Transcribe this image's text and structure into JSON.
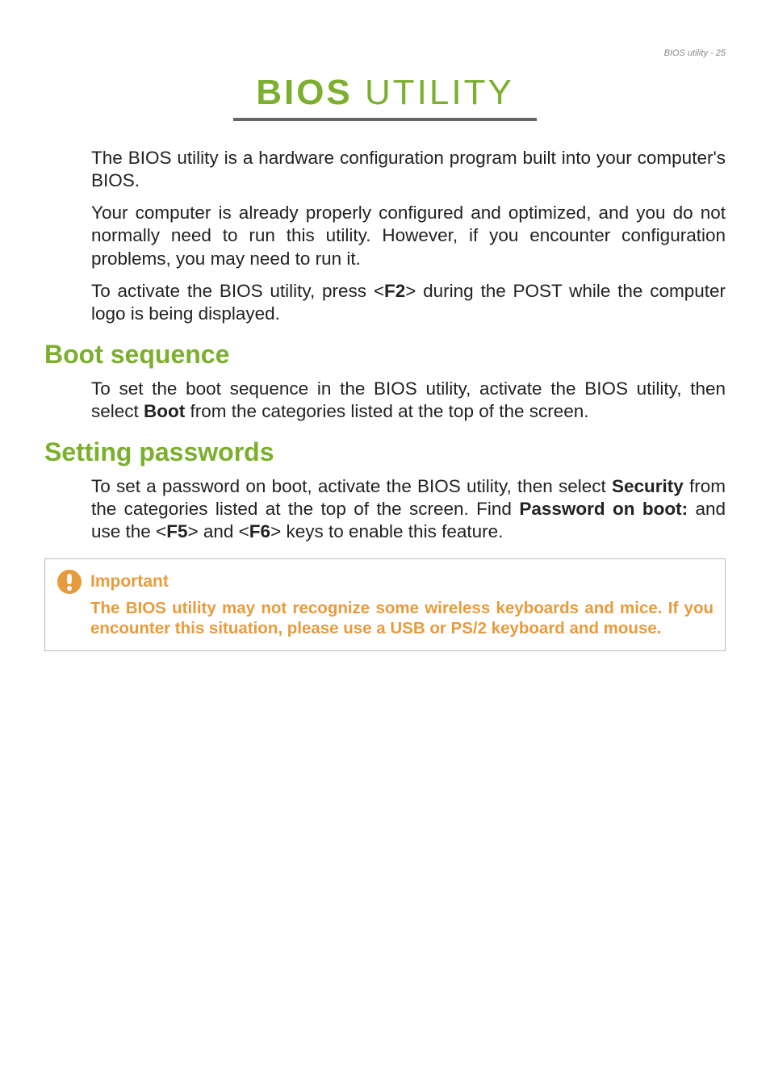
{
  "header": {
    "running_head": "BIOS utility - 25"
  },
  "title": {
    "bios": "BIOS",
    "utility": " UTILITY"
  },
  "intro": {
    "p1": "The BIOS utility is a hardware configuration program built into your computer's BIOS.",
    "p2": "Your computer is already properly configured and optimized, and you do not normally need to run this utility. However, if you encounter configuration problems, you may need to run it.",
    "p3_a": "To activate the BIOS utility, press <",
    "p3_key": "F2",
    "p3_b": "> during the POST while the computer logo is being displayed."
  },
  "sections": {
    "boot": {
      "heading": "Boot sequence",
      "p1_a": "To set the boot sequence in the BIOS utility, activate the BIOS utility, then select ",
      "p1_bold": "Boot",
      "p1_b": " from the categories listed at the top of the screen."
    },
    "passwords": {
      "heading": "Setting passwords",
      "p1_a": "To set a password on boot, activate the BIOS utility, then select ",
      "p1_bold1": "Security",
      "p1_b": " from the categories listed at the top of the screen. Find ",
      "p1_bold2": "Password on boot:",
      "p1_c": " and use the <",
      "p1_key1": "F5",
      "p1_d": "> and <",
      "p1_key2": "F6",
      "p1_e": "> keys to enable this feature."
    }
  },
  "callout": {
    "title": "Important",
    "text": "The BIOS utility may  not recognize some wireless keyboards and mice. If you encounter this situation, please use a USB or PS/2 keyboard and mouse."
  }
}
